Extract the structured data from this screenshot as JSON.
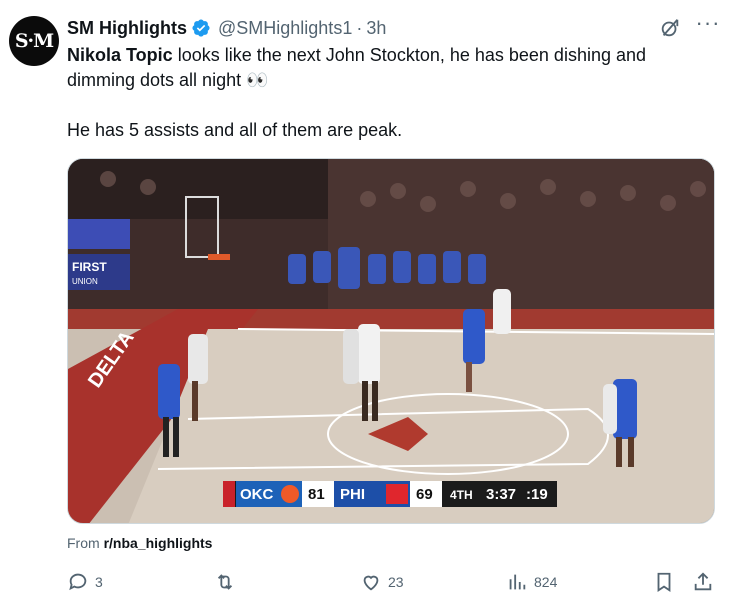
{
  "author": {
    "avatar_text": "S·M",
    "name": "SM Highlights",
    "handle": "@SMHighlights1",
    "separator": "·",
    "time": "3h"
  },
  "post": {
    "line1_bold": "Nikola Topic",
    "line1_rest": " looks like the next John Stockton, he has been dishing and dimming dots all night 👀",
    "line2": "He has 5 assists and all of them are peak."
  },
  "video": {
    "scoreboard": {
      "team1": "OKC",
      "score1": "81",
      "team2": "PHI",
      "score2": "69",
      "period": "4TH",
      "clock": "3:37",
      "shot_clock": ":19"
    },
    "court_text": {
      "sideline": "DELTA",
      "banner": "FIRST",
      "banner_sub": "UNION"
    }
  },
  "source": {
    "prefix": "From ",
    "name": "r/nba_highlights"
  },
  "actions": {
    "replies": "3",
    "reposts": "",
    "likes": "23",
    "views": "824"
  },
  "icons": [
    "verified-badge-icon",
    "grok-icon",
    "more-icon",
    "reply-icon",
    "repost-icon",
    "like-icon",
    "views-icon",
    "bookmark-icon",
    "share-icon"
  ],
  "colors": {
    "verified": "#1d9bf0",
    "muted": "#536471",
    "text": "#0f1419"
  }
}
